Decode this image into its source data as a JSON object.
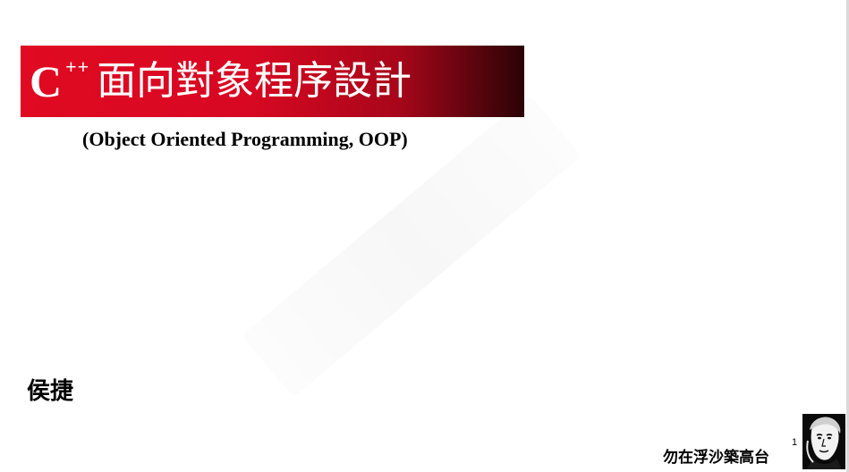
{
  "slide": {
    "title": {
      "c": "C",
      "plusplus": "++",
      "chinese": "面向對象程序設計"
    },
    "subtitle": "(Object Oriented Programming, OOP)",
    "author": "侯捷",
    "motto": "勿在浮沙築高台",
    "page_number": "1"
  },
  "colors": {
    "title_bar_start": "#e00a22",
    "title_bar_end": "#2a0306",
    "title_text": "#ffffff",
    "body_text": "#000000"
  }
}
